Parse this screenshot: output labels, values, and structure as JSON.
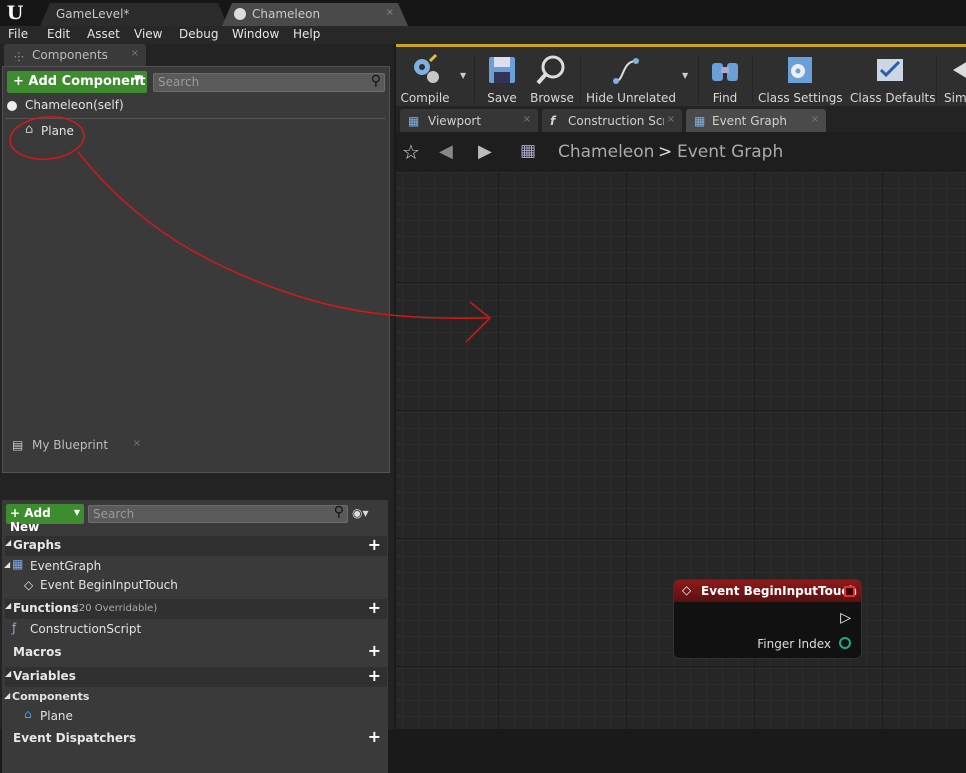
{
  "titlebar": {
    "tabs": [
      {
        "label": "GameLevel*"
      },
      {
        "label": "Chameleon"
      }
    ]
  },
  "menu": [
    "File",
    "Edit",
    "Asset",
    "View",
    "Debug",
    "Window",
    "Help"
  ],
  "components_panel": {
    "tab_label": "Components",
    "add_button": "+ Add Component",
    "search_placeholder": "Search",
    "root": "Chameleon(self)",
    "child": "Plane"
  },
  "blueprint_panel": {
    "tab_label": "My Blueprint",
    "add_button": "+ Add New",
    "search_placeholder": "Search",
    "graphs": {
      "title": "Graphs",
      "items": [
        "EventGraph",
        "Event BeginInputTouch"
      ]
    },
    "functions": {
      "title": "Functions",
      "note": "(20 Overridable)",
      "items": [
        "ConstructionScript"
      ]
    },
    "macros": {
      "title": "Macros"
    },
    "variables": {
      "title": "Variables",
      "subcategory": "Components",
      "items": [
        "Plane"
      ]
    },
    "dispatchers": {
      "title": "Event Dispatchers"
    }
  },
  "toolbar": [
    "Compile",
    "Save",
    "Browse",
    "Hide Unrelated",
    "Find",
    "Class Settings",
    "Class Defaults",
    "Sim"
  ],
  "graph_tabs": [
    "Viewport",
    "Construction Scrip",
    "Event Graph"
  ],
  "breadcrumb": {
    "root": "Chameleon",
    "sep": ">",
    "current": "Event Graph"
  },
  "node": {
    "title": "Event BeginInputTouch",
    "pin": "Finger Index"
  },
  "colors": {
    "accent": "#c9a227",
    "green_button": "#3d8c2e",
    "node_header": "#8e1a1a",
    "annotation": "#d11a1a"
  }
}
